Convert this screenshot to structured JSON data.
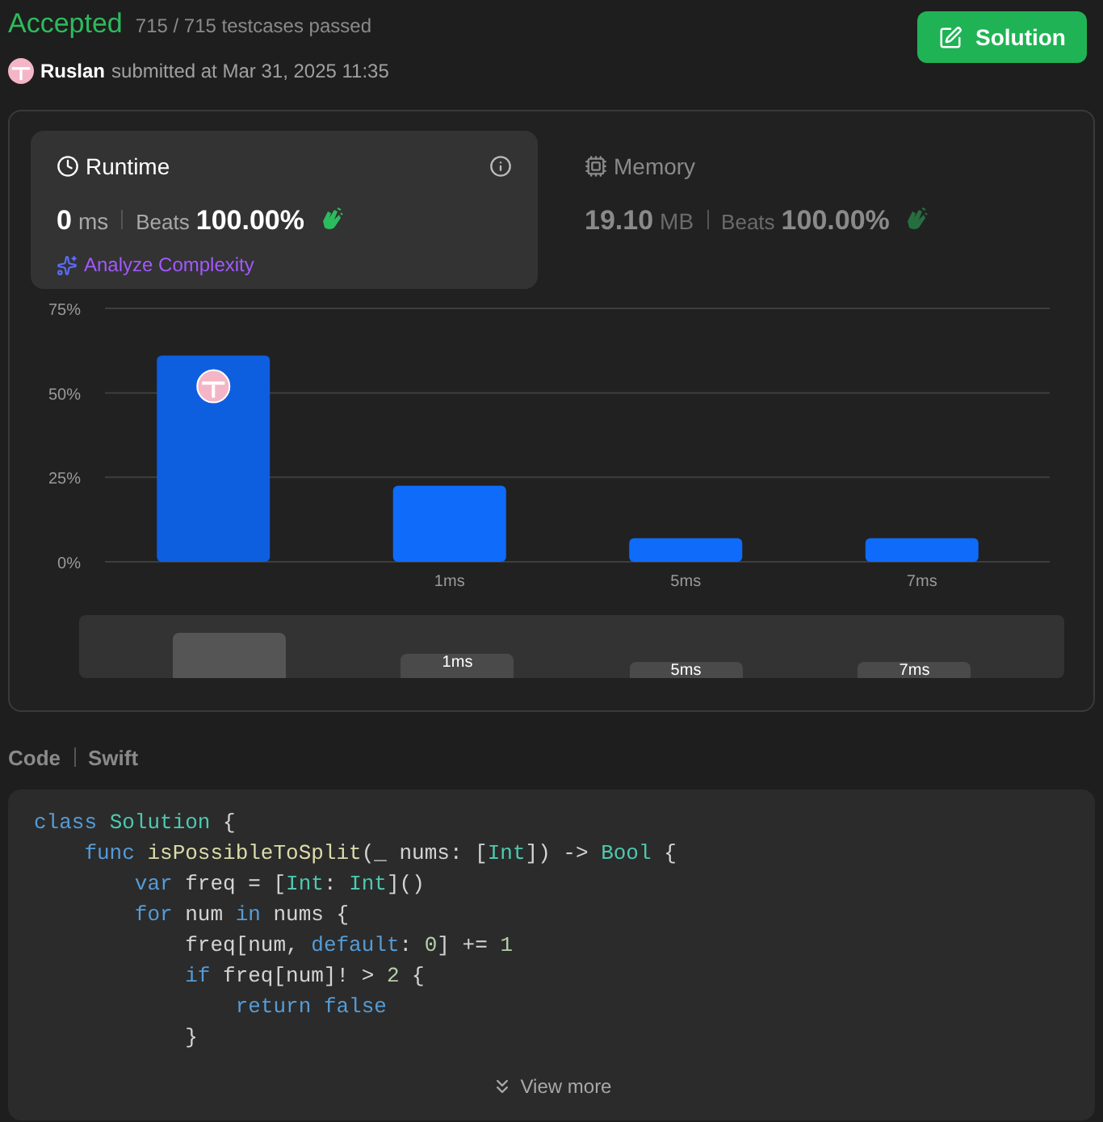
{
  "header": {
    "status": "Accepted",
    "testcases": "715 / 715 testcases passed",
    "user": "Ruslan",
    "submitted": "submitted at Mar 31, 2025 11:35",
    "solution_button": "Solution"
  },
  "metrics": [
    {
      "kind": "runtime",
      "label": "Runtime",
      "selected": true,
      "value": "0",
      "unit": "ms",
      "beats_label": "Beats",
      "beats": "100.00%",
      "link": "Analyze Complexity"
    },
    {
      "kind": "memory",
      "label": "Memory",
      "selected": false,
      "value": "19.10",
      "unit": "MB",
      "beats_label": "Beats",
      "beats": "100.00%"
    }
  ],
  "chart_data": {
    "type": "bar",
    "categories": [
      null,
      "1ms",
      "5ms",
      "7ms"
    ],
    "values": [
      61,
      22.5,
      7,
      7
    ],
    "ylim": [
      0,
      75
    ],
    "yticks": [
      {
        "value": 0,
        "label": "0%"
      },
      {
        "value": 25,
        "label": "25%"
      },
      {
        "value": 50,
        "label": "50%"
      },
      {
        "value": 75,
        "label": "75%"
      }
    ]
  },
  "overview": {
    "labels": [
      "1ms",
      "5ms",
      "7ms"
    ]
  },
  "code_section": {
    "label": "Code",
    "language": "Swift",
    "view_more": "View more",
    "lines": [
      {
        "tokens": [
          {
            "kind": "keyword",
            "text": "class "
          },
          {
            "kind": "type",
            "text": "Solution"
          },
          {
            "kind": "plain",
            "text": " {"
          }
        ]
      },
      {
        "tokens": [
          {
            "kind": "keyword",
            "text": "    func "
          },
          {
            "kind": "function",
            "text": "isPossibleToSplit"
          },
          {
            "kind": "plain",
            "text": "(_ nums: ["
          },
          {
            "kind": "type",
            "text": "Int"
          },
          {
            "kind": "plain",
            "text": "]) -> "
          },
          {
            "kind": "type",
            "text": "Bool"
          },
          {
            "kind": "plain",
            "text": " {"
          }
        ]
      },
      {
        "tokens": [
          {
            "kind": "keyword",
            "text": "        var"
          },
          {
            "kind": "plain",
            "text": " freq = ["
          },
          {
            "kind": "type",
            "text": "Int"
          },
          {
            "kind": "plain",
            "text": ": "
          },
          {
            "kind": "type",
            "text": "Int"
          },
          {
            "kind": "plain",
            "text": "]()"
          }
        ]
      },
      {
        "tokens": [
          {
            "kind": "keyword",
            "text": "        for"
          },
          {
            "kind": "plain",
            "text": " num "
          },
          {
            "kind": "keyword",
            "text": "in"
          },
          {
            "kind": "plain",
            "text": " nums {"
          }
        ]
      },
      {
        "tokens": [
          {
            "kind": "plain",
            "text": "            freq[num, "
          },
          {
            "kind": "keyword",
            "text": "default"
          },
          {
            "kind": "plain",
            "text": ": "
          },
          {
            "kind": "number",
            "text": "0"
          },
          {
            "kind": "plain",
            "text": "] += "
          },
          {
            "kind": "number",
            "text": "1"
          }
        ]
      },
      {
        "tokens": [
          {
            "kind": "keyword",
            "text": "            if"
          },
          {
            "kind": "plain",
            "text": " freq[num]! > "
          },
          {
            "kind": "number",
            "text": "2"
          },
          {
            "kind": "plain",
            "text": " {"
          }
        ]
      },
      {
        "tokens": [
          {
            "kind": "keyword",
            "text": "                return "
          },
          {
            "kind": "keyword",
            "text": "false"
          }
        ]
      },
      {
        "tokens": [
          {
            "kind": "plain",
            "text": "            }"
          }
        ]
      }
    ]
  }
}
